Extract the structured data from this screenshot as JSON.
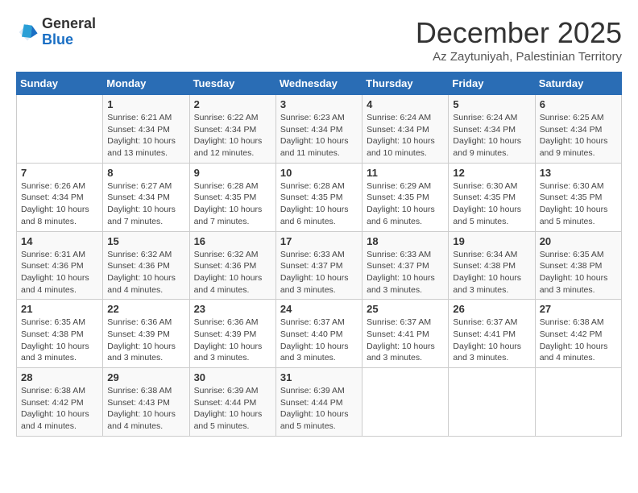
{
  "header": {
    "logo_general": "General",
    "logo_blue": "Blue",
    "month_title": "December 2025",
    "subtitle": "Az Zaytuniyah, Palestinian Territory"
  },
  "days_of_week": [
    "Sunday",
    "Monday",
    "Tuesday",
    "Wednesday",
    "Thursday",
    "Friday",
    "Saturday"
  ],
  "weeks": [
    [
      {
        "day": "",
        "info": ""
      },
      {
        "day": "1",
        "info": "Sunrise: 6:21 AM\nSunset: 4:34 PM\nDaylight: 10 hours\nand 13 minutes."
      },
      {
        "day": "2",
        "info": "Sunrise: 6:22 AM\nSunset: 4:34 PM\nDaylight: 10 hours\nand 12 minutes."
      },
      {
        "day": "3",
        "info": "Sunrise: 6:23 AM\nSunset: 4:34 PM\nDaylight: 10 hours\nand 11 minutes."
      },
      {
        "day": "4",
        "info": "Sunrise: 6:24 AM\nSunset: 4:34 PM\nDaylight: 10 hours\nand 10 minutes."
      },
      {
        "day": "5",
        "info": "Sunrise: 6:24 AM\nSunset: 4:34 PM\nDaylight: 10 hours\nand 9 minutes."
      },
      {
        "day": "6",
        "info": "Sunrise: 6:25 AM\nSunset: 4:34 PM\nDaylight: 10 hours\nand 9 minutes."
      }
    ],
    [
      {
        "day": "7",
        "info": "Sunrise: 6:26 AM\nSunset: 4:34 PM\nDaylight: 10 hours\nand 8 minutes."
      },
      {
        "day": "8",
        "info": "Sunrise: 6:27 AM\nSunset: 4:34 PM\nDaylight: 10 hours\nand 7 minutes."
      },
      {
        "day": "9",
        "info": "Sunrise: 6:28 AM\nSunset: 4:35 PM\nDaylight: 10 hours\nand 7 minutes."
      },
      {
        "day": "10",
        "info": "Sunrise: 6:28 AM\nSunset: 4:35 PM\nDaylight: 10 hours\nand 6 minutes."
      },
      {
        "day": "11",
        "info": "Sunrise: 6:29 AM\nSunset: 4:35 PM\nDaylight: 10 hours\nand 6 minutes."
      },
      {
        "day": "12",
        "info": "Sunrise: 6:30 AM\nSunset: 4:35 PM\nDaylight: 10 hours\nand 5 minutes."
      },
      {
        "day": "13",
        "info": "Sunrise: 6:30 AM\nSunset: 4:35 PM\nDaylight: 10 hours\nand 5 minutes."
      }
    ],
    [
      {
        "day": "14",
        "info": "Sunrise: 6:31 AM\nSunset: 4:36 PM\nDaylight: 10 hours\nand 4 minutes."
      },
      {
        "day": "15",
        "info": "Sunrise: 6:32 AM\nSunset: 4:36 PM\nDaylight: 10 hours\nand 4 minutes."
      },
      {
        "day": "16",
        "info": "Sunrise: 6:32 AM\nSunset: 4:36 PM\nDaylight: 10 hours\nand 4 minutes."
      },
      {
        "day": "17",
        "info": "Sunrise: 6:33 AM\nSunset: 4:37 PM\nDaylight: 10 hours\nand 3 minutes."
      },
      {
        "day": "18",
        "info": "Sunrise: 6:33 AM\nSunset: 4:37 PM\nDaylight: 10 hours\nand 3 minutes."
      },
      {
        "day": "19",
        "info": "Sunrise: 6:34 AM\nSunset: 4:38 PM\nDaylight: 10 hours\nand 3 minutes."
      },
      {
        "day": "20",
        "info": "Sunrise: 6:35 AM\nSunset: 4:38 PM\nDaylight: 10 hours\nand 3 minutes."
      }
    ],
    [
      {
        "day": "21",
        "info": "Sunrise: 6:35 AM\nSunset: 4:38 PM\nDaylight: 10 hours\nand 3 minutes."
      },
      {
        "day": "22",
        "info": "Sunrise: 6:36 AM\nSunset: 4:39 PM\nDaylight: 10 hours\nand 3 minutes."
      },
      {
        "day": "23",
        "info": "Sunrise: 6:36 AM\nSunset: 4:39 PM\nDaylight: 10 hours\nand 3 minutes."
      },
      {
        "day": "24",
        "info": "Sunrise: 6:37 AM\nSunset: 4:40 PM\nDaylight: 10 hours\nand 3 minutes."
      },
      {
        "day": "25",
        "info": "Sunrise: 6:37 AM\nSunset: 4:41 PM\nDaylight: 10 hours\nand 3 minutes."
      },
      {
        "day": "26",
        "info": "Sunrise: 6:37 AM\nSunset: 4:41 PM\nDaylight: 10 hours\nand 3 minutes."
      },
      {
        "day": "27",
        "info": "Sunrise: 6:38 AM\nSunset: 4:42 PM\nDaylight: 10 hours\nand 4 minutes."
      }
    ],
    [
      {
        "day": "28",
        "info": "Sunrise: 6:38 AM\nSunset: 4:42 PM\nDaylight: 10 hours\nand 4 minutes."
      },
      {
        "day": "29",
        "info": "Sunrise: 6:38 AM\nSunset: 4:43 PM\nDaylight: 10 hours\nand 4 minutes."
      },
      {
        "day": "30",
        "info": "Sunrise: 6:39 AM\nSunset: 4:44 PM\nDaylight: 10 hours\nand 5 minutes."
      },
      {
        "day": "31",
        "info": "Sunrise: 6:39 AM\nSunset: 4:44 PM\nDaylight: 10 hours\nand 5 minutes."
      },
      {
        "day": "",
        "info": ""
      },
      {
        "day": "",
        "info": ""
      },
      {
        "day": "",
        "info": ""
      }
    ]
  ]
}
